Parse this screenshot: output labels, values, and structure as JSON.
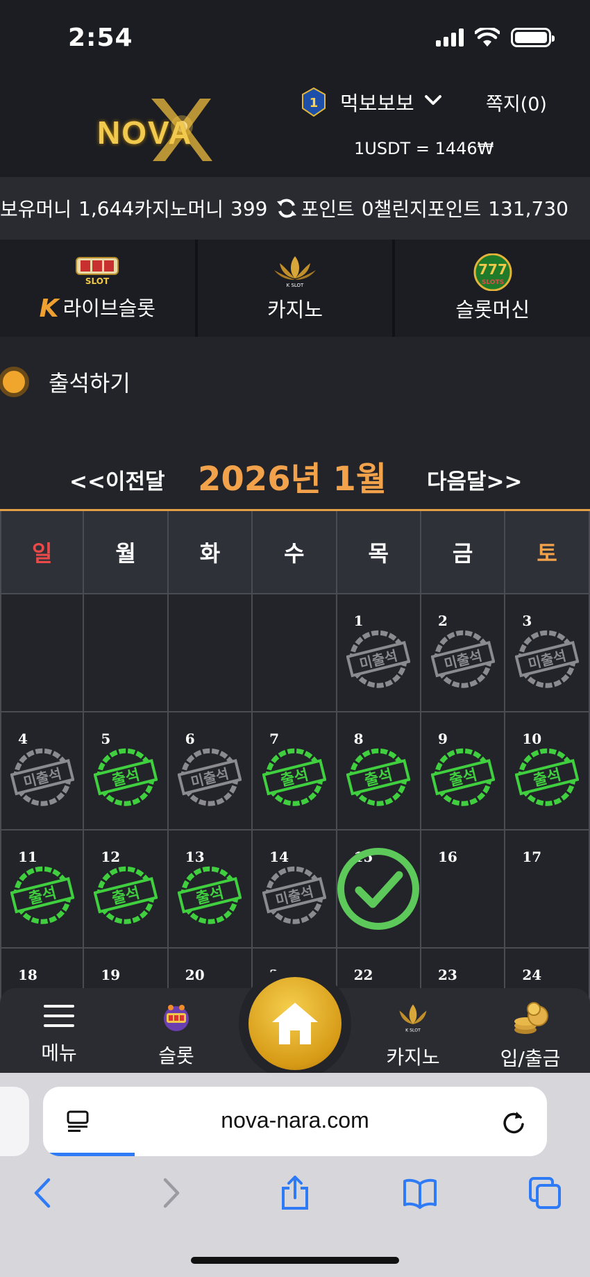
{
  "status": {
    "time": "2:54"
  },
  "header": {
    "logo_text": "NOVA",
    "level": "1",
    "username": "먹보보보",
    "messages_label": "쪽지(0)",
    "rate": "1USDT = 1446₩"
  },
  "money": {
    "holding_label": "보유머니",
    "holding_value": "1,644",
    "casino_label": "카지노머니",
    "casino_value": "399",
    "point_label": "포인트",
    "point_value": "0",
    "challenge_label": "챌린지포인트",
    "challenge_value": "131,730"
  },
  "game_tabs": [
    {
      "label": "라이브슬롯",
      "icon": "live-slot-icon"
    },
    {
      "label": "카지노",
      "icon": "k-slot-lotus-icon"
    },
    {
      "label": "슬롯머신",
      "icon": "777-slots-icon"
    }
  ],
  "attendance": {
    "title": "출석하기",
    "prev_label": "<<이전달",
    "month_label": "2026년 1월",
    "next_label": "다음달>>",
    "weekdays": [
      "일",
      "월",
      "화",
      "수",
      "목",
      "금",
      "토"
    ],
    "weekday_colors": {
      "sun": "#e84a4a",
      "sat": "#f2a24a",
      "default": "#ffffff"
    },
    "stamp_present": "출석",
    "stamp_absent": "미출석",
    "weeks": [
      [
        {
          "day": "",
          "status": "none"
        },
        {
          "day": "",
          "status": "none"
        },
        {
          "day": "",
          "status": "none"
        },
        {
          "day": "",
          "status": "none"
        },
        {
          "day": "1",
          "status": "absent"
        },
        {
          "day": "2",
          "status": "absent"
        },
        {
          "day": "3",
          "status": "absent"
        }
      ],
      [
        {
          "day": "4",
          "status": "absent"
        },
        {
          "day": "5",
          "status": "present"
        },
        {
          "day": "6",
          "status": "absent"
        },
        {
          "day": "7",
          "status": "present"
        },
        {
          "day": "8",
          "status": "present"
        },
        {
          "day": "9",
          "status": "present"
        },
        {
          "day": "10",
          "status": "present"
        }
      ],
      [
        {
          "day": "11",
          "status": "present"
        },
        {
          "day": "12",
          "status": "present"
        },
        {
          "day": "13",
          "status": "present"
        },
        {
          "day": "14",
          "status": "absent"
        },
        {
          "day": "15",
          "status": "today"
        },
        {
          "day": "16",
          "status": "none"
        },
        {
          "day": "17",
          "status": "none"
        }
      ],
      [
        {
          "day": "18",
          "status": "none"
        },
        {
          "day": "19",
          "status": "none"
        },
        {
          "day": "20",
          "status": "none"
        },
        {
          "day": "21",
          "status": "none"
        },
        {
          "day": "22",
          "status": "none"
        },
        {
          "day": "23",
          "status": "none"
        },
        {
          "day": "24",
          "status": "none"
        }
      ]
    ]
  },
  "bottom_nav": {
    "menu": "메뉴",
    "slot": "슬롯",
    "casino": "카지노",
    "deposit": "입/출금"
  },
  "browser": {
    "url": "nova-nara.com"
  }
}
